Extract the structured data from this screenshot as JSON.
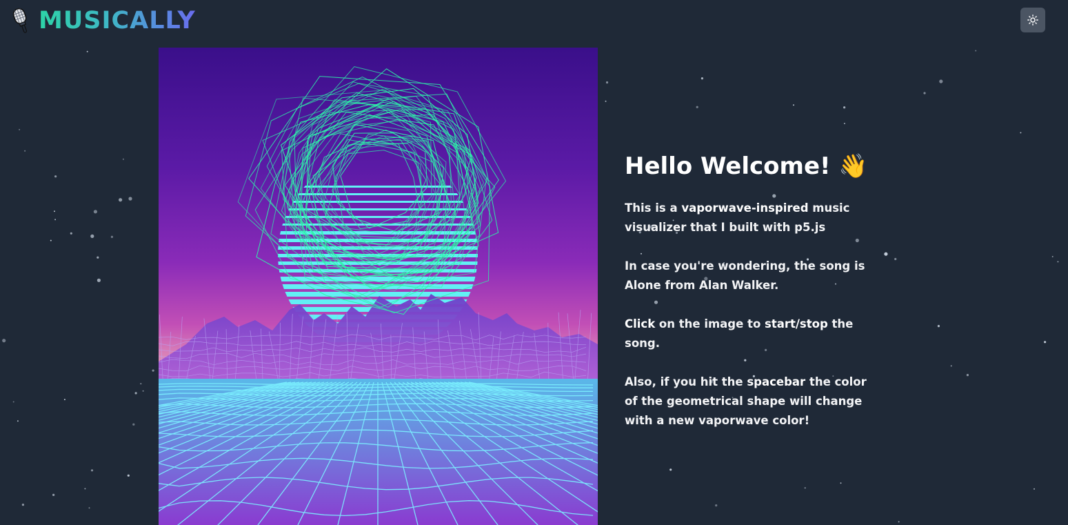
{
  "header": {
    "logo_icon": "microphone-icon",
    "logo_text": "MUSICALLY",
    "theme_toggle_icon": "sun-icon"
  },
  "visualizer": {
    "description_icon": "vaporwave-canvas"
  },
  "content": {
    "heading": "Hello Welcome!",
    "heading_emoji": "👋",
    "p1": {
      "a": "This is a ",
      "b": "vaporwave-inspired",
      "c": " music visualizer that I built with p5.js"
    },
    "p2": {
      "a": "In case you're wondering, the song is Alone from Alan Walker."
    },
    "p3": {
      "a": "Click",
      "b": " on the image to ",
      "c": "start/stop",
      "d": " the song."
    },
    "p4": {
      "a": "Also, if you hit the ",
      "b": "spacebar",
      "c": " the color of the geometrical shape will change with a new vaporwave color!"
    }
  },
  "colors": {
    "background": "#1f2937",
    "toggle_bg": "#4b5563",
    "logo_gradient_start": "#2dd4a7",
    "logo_gradient_end": "#6a6cf0",
    "shape_color": "#2df5a8",
    "grid_color": "#6ee7f5"
  }
}
